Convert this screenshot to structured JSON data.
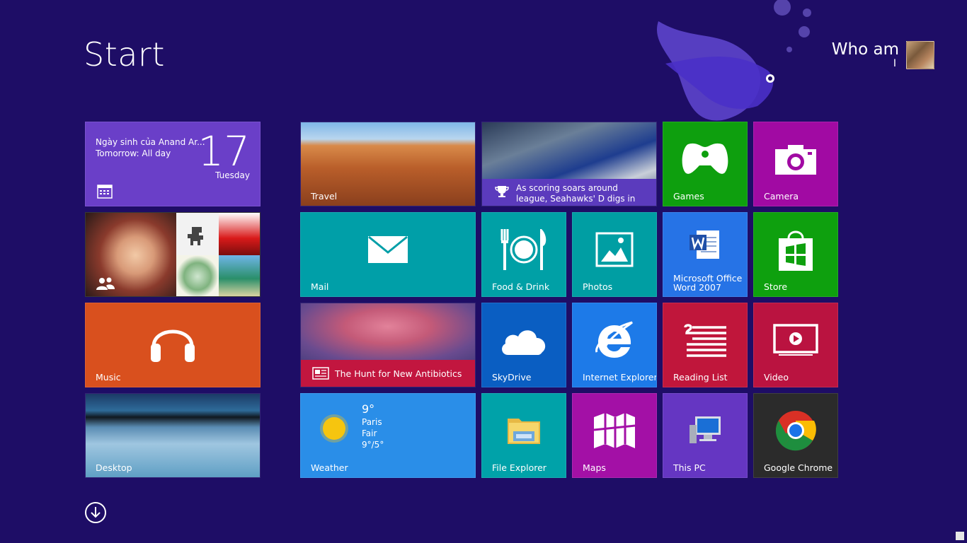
{
  "screen": {
    "title": "Start"
  },
  "user": {
    "name_line1": "Who am",
    "name_line2": "I"
  },
  "colors": {
    "background": "#1e0d66",
    "calendar": "#6a3fc8",
    "music": "#d9501e",
    "mail": "#009fa8",
    "food": "#00a0a6",
    "photos": "#009ea3",
    "games": "#0e9f0e",
    "camera": "#a10aa3",
    "word": "#2673e6",
    "store": "#0ea00e",
    "skydrive": "#0a5ec2",
    "ie": "#1d7ae8",
    "reading_list": "#c0163b",
    "video": "#ba1340",
    "weather": "#2a8ee8",
    "file_explorer": "#00a2a9",
    "maps": "#a310a6",
    "this_pc": "#6536c2",
    "chrome": "#2b2b2b"
  },
  "tiles": {
    "calendar": {
      "event": "Ngày sinh của Anand Ar...",
      "when": "Tomorrow: All day",
      "day": "17",
      "weekday": "Tuesday",
      "icon": "calendar-icon"
    },
    "people": {
      "icon": "people-icon"
    },
    "music": {
      "label": "Music",
      "icon": "headphones-icon"
    },
    "desktop": {
      "label": "Desktop"
    },
    "travel": {
      "label": "Travel"
    },
    "sports": {
      "caption": "As scoring soars around league, Seahawks' D digs in",
      "icon": "trophy-icon"
    },
    "mail": {
      "label": "Mail",
      "icon": "envelope-icon"
    },
    "news": {
      "caption": "The Hunt for New Antibiotics",
      "icon": "newspaper-icon"
    },
    "weather": {
      "label": "Weather",
      "temp": "9°",
      "city": "Paris",
      "condition": "Fair",
      "range": "9°/5°",
      "icon": "sun-icon"
    },
    "food": {
      "label": "Food & Drink",
      "icon": "plate-cutlery-icon"
    },
    "photos": {
      "label": "Photos",
      "icon": "picture-icon"
    },
    "skydrive": {
      "label": "SkyDrive",
      "icon": "cloud-icon"
    },
    "ie": {
      "label": "Internet Explorer",
      "icon": "ie-icon"
    },
    "file_explorer": {
      "label": "File Explorer",
      "icon": "folder-icon"
    },
    "maps": {
      "label": "Maps",
      "icon": "map-icon"
    },
    "games": {
      "label": "Games",
      "icon": "controller-icon"
    },
    "camera": {
      "label": "Camera",
      "icon": "camera-icon"
    },
    "word": {
      "label": "Microsoft Office Word 2007",
      "icon": "word-icon"
    },
    "store": {
      "label": "Store",
      "icon": "store-bag-icon"
    },
    "reading_list": {
      "label": "Reading List",
      "icon": "reading-list-icon"
    },
    "video": {
      "label": "Video",
      "icon": "video-icon"
    },
    "this_pc": {
      "label": "This PC",
      "icon": "computer-icon"
    },
    "chrome": {
      "label": "Google Chrome",
      "icon": "chrome-icon"
    }
  },
  "controls": {
    "all_apps_icon": "arrow-down-circle-icon"
  }
}
